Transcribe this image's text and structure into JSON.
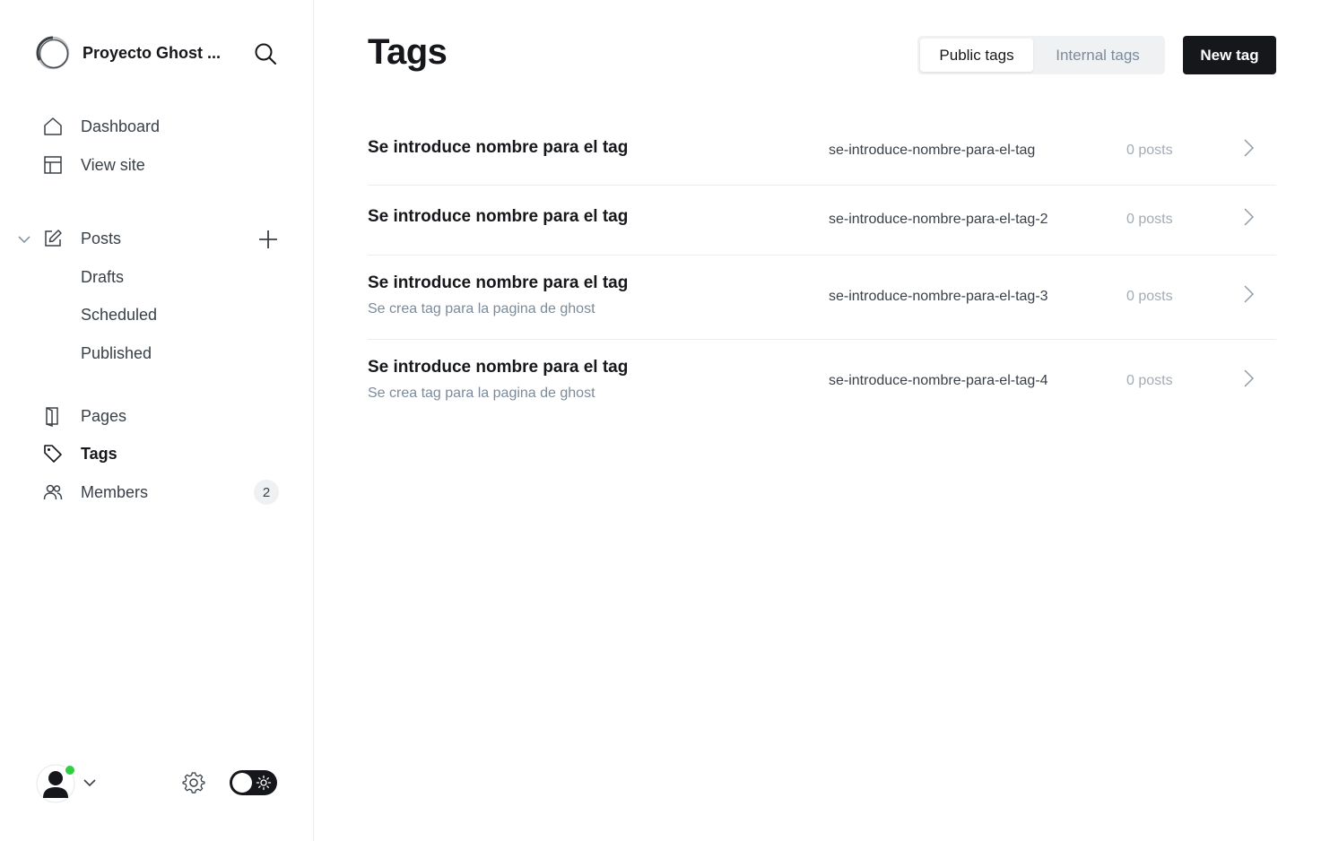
{
  "sidebar": {
    "site_title": "Proyecto Ghost ...",
    "nav": {
      "dashboard": "Dashboard",
      "view_site": "View site",
      "posts": "Posts",
      "drafts": "Drafts",
      "scheduled": "Scheduled",
      "published": "Published",
      "pages": "Pages",
      "tags": "Tags",
      "members": "Members",
      "members_count": "2"
    }
  },
  "header": {
    "title": "Tags",
    "filters": {
      "public": "Public tags",
      "internal": "Internal tags",
      "selected": "Public tags"
    },
    "new_tag_label": "New tag"
  },
  "tags": [
    {
      "name": "Se introduce nombre para el tag",
      "description": "",
      "slug": "se-introduce-nombre-para-el-tag",
      "count": "0 posts"
    },
    {
      "name": "Se introduce nombre para el tag",
      "description": "",
      "slug": "se-introduce-nombre-para-el-tag-2",
      "count": "0 posts"
    },
    {
      "name": "Se introduce nombre para el tag",
      "description": "Se crea tag para la pagina de ghost",
      "slug": "se-introduce-nombre-para-el-tag-3",
      "count": "0 posts"
    },
    {
      "name": "Se introduce nombre para el tag",
      "description": "Se crea tag para la pagina de ghost",
      "slug": "se-introduce-nombre-para-el-tag-4",
      "count": "0 posts"
    }
  ],
  "icons": {
    "search": "search-icon",
    "dashboard": "home-icon",
    "view_site": "layout-icon",
    "posts": "edit-icon",
    "pages": "page-icon",
    "tags": "tag-icon",
    "members": "users-icon",
    "settings": "gear-icon",
    "theme": "sun-icon"
  },
  "colors": {
    "accent": "#15171a",
    "online": "#30cf43",
    "muted": "#7c8b9a"
  }
}
